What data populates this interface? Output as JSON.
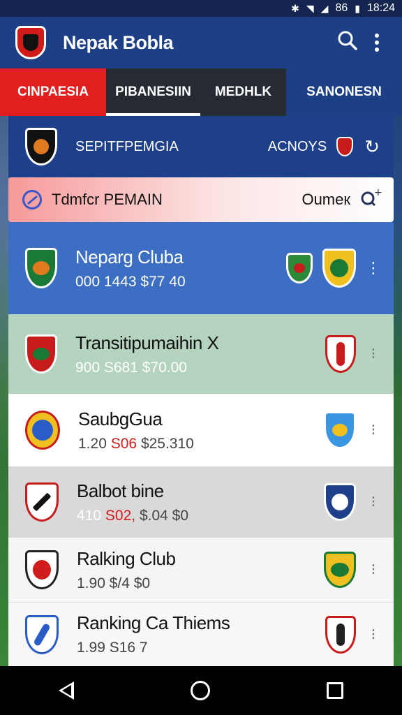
{
  "status_bar": {
    "time": "18:24",
    "battery_text": "86"
  },
  "app": {
    "title": "Nepak Bobla"
  },
  "tabs": [
    {
      "label": "CINPAESIA"
    },
    {
      "label": "PIBANESIIN"
    },
    {
      "label": "MEDHLK"
    },
    {
      "label": "SANONESN"
    }
  ],
  "league": {
    "name": "SEPITFPEMGIA",
    "action": "ACNOYS"
  },
  "search": {
    "text": "Tdmfcr PEMAIN",
    "filter": "Oumeк"
  },
  "rows": [
    {
      "name": "Neparg Cluba",
      "stats": "000 1443 $77 40",
      "crest_color": "#1a7a35",
      "opp1_color": "#2a8a3a",
      "opp2_color": "#f0c020"
    },
    {
      "name": "Transitipumaihin X",
      "stats": "900 S681 $70.00",
      "crest_color": "#c81c1c",
      "opp2_color": "#c81c1c"
    },
    {
      "name": "SaubgGua",
      "stats_a": "1.20",
      "stats_b": "S06",
      "stats_c": "$25.310",
      "crest_color": "#f0c020",
      "opp2_color": "#3a96e0"
    },
    {
      "name": "Balbot bine",
      "stats_a": "410",
      "stats_b": "S02,",
      "stats_c": "$.04 $0",
      "crest_color": "#c81c1c",
      "opp2_color": "#1e3f8a"
    },
    {
      "name": "Ralking Club",
      "stats": "1.90 $/4 $0",
      "crest_color": "#d01c1c",
      "opp2_color": "#f0c020"
    },
    {
      "name": "Ranking Ca Thiems",
      "stats": "1.99 S16 7",
      "crest_color": "#2a5cc8",
      "opp2_color": "#c81c1c"
    }
  ],
  "icons": {
    "search": "search-icon",
    "menu": "kebab-menu-icon",
    "refresh": "refresh-icon",
    "block": "block-icon",
    "zoom": "zoom-icon"
  },
  "colors": {
    "app_bar": "#1d3f86",
    "active_tab": "#e11f1f",
    "selected_row": "#3c6fc4"
  }
}
